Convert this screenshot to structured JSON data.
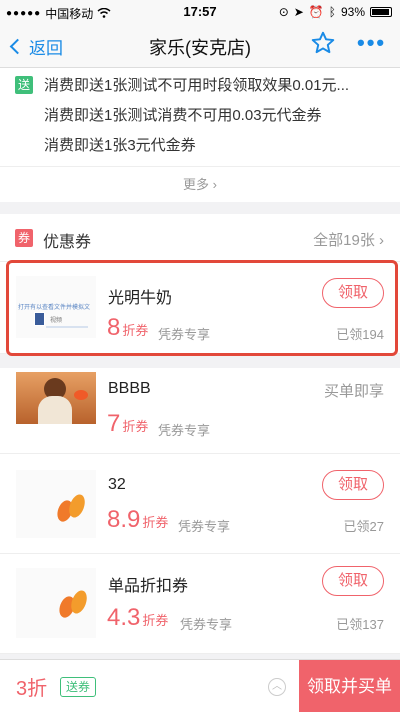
{
  "status_bar": {
    "carrier": "中国移动",
    "time": "17:57",
    "battery": "93%"
  },
  "nav": {
    "back_label": "返回",
    "title": "家乐(安克店)"
  },
  "promo": {
    "badge": "送",
    "lines": [
      "消费即送1张测试不可用时段领取效果0.01元...",
      "消费即送1张测试消费不可用0.03元代金券",
      "消费即送1张3元代金券"
    ],
    "more_label": "更多"
  },
  "coupons": {
    "badge": "券",
    "title": "优惠券",
    "all_label": "全部19张",
    "items": [
      {
        "name": "光明牛奶",
        "discount": "8",
        "unit": "折券",
        "tag": "凭券专享",
        "button": "领取",
        "status": "已领194"
      },
      {
        "name": "BBBB",
        "discount": "7",
        "unit": "折券",
        "tag": "凭券专享",
        "right_label": "买单即享"
      },
      {
        "name": "32",
        "discount": "8.9",
        "unit": "折券",
        "tag": "凭券专享",
        "button": "领取",
        "status": "已领27"
      },
      {
        "name": "单品折扣券",
        "discount": "4.3",
        "unit": "折券",
        "tag": "凭券专享",
        "button": "领取",
        "status": "已领137"
      }
    ],
    "thumb1_text": "打开有以查看文件并模拟文",
    "thumb1_sub": "视频"
  },
  "bottom_bar": {
    "discount": "3折",
    "badge": "送券",
    "cta": "领取并买单"
  },
  "colors": {
    "accent_blue": "#1a8be6",
    "accent_red": "#f0636b",
    "green": "#3fbf7a",
    "highlight": "#e2483a"
  }
}
